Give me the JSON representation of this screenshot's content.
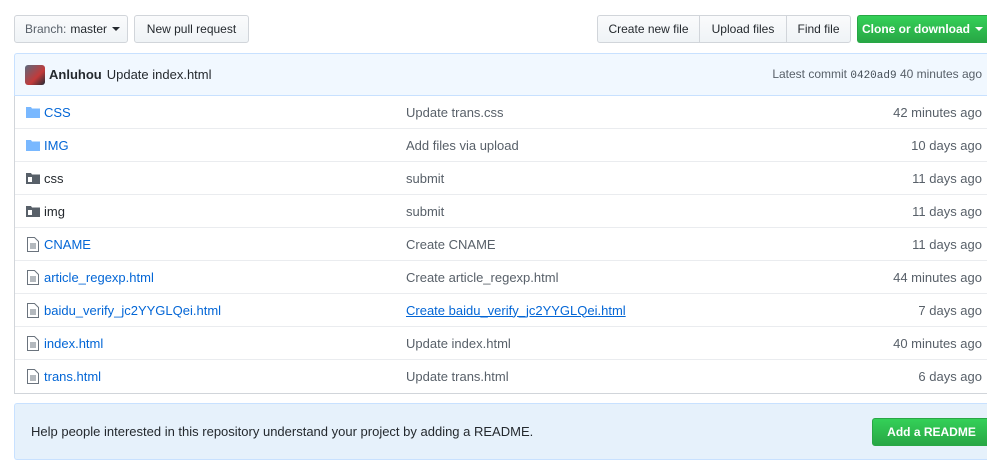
{
  "toolbar": {
    "branch_prefix": "Branch:",
    "branch_name": "master",
    "new_pull_request": "New pull request",
    "create_new_file": "Create new file",
    "upload_files": "Upload files",
    "find_file": "Find file",
    "clone_or_download": "Clone or download"
  },
  "commit": {
    "author": "Anluhou",
    "message": "Update index.html",
    "prefix": "Latest commit",
    "sha": "0420ad9",
    "age": "40 minutes ago"
  },
  "files": [
    {
      "name": "CSS",
      "icon": "folder-icon",
      "message": "Update trans.css",
      "age": "42 minutes ago"
    },
    {
      "name": "IMG",
      "icon": "folder-icon",
      "message": "Add files via upload",
      "age": "10 days ago"
    },
    {
      "name": "css",
      "icon": "submodule-icon",
      "message": "submit",
      "age": "11 days ago"
    },
    {
      "name": "img",
      "icon": "submodule-icon",
      "message": "submit",
      "age": "11 days ago"
    },
    {
      "name": "CNAME",
      "icon": "file-icon",
      "message": "Create CNAME",
      "age": "11 days ago"
    },
    {
      "name": "article_regexp.html",
      "icon": "file-icon",
      "message": "Create article_regexp.html",
      "age": "44 minutes ago"
    },
    {
      "name": "baidu_verify_jc2YYGLQei.html",
      "icon": "file-icon",
      "message": "Create baidu_verify_jc2YYGLQei.html",
      "age": "7 days ago"
    },
    {
      "name": "index.html",
      "icon": "file-icon",
      "message": "Update index.html",
      "age": "40 minutes ago"
    },
    {
      "name": "trans.html",
      "icon": "file-icon",
      "message": "Update trans.html",
      "age": "6 days ago"
    }
  ],
  "readme": {
    "text": "Help people interested in this repository understand your project by adding a README.",
    "button": "Add a README"
  },
  "colors": {
    "link": "#0366d6",
    "primary_green": "#28a745",
    "commit_bar_bg": "#f1f8ff",
    "readme_bg": "#e6f1fb"
  }
}
